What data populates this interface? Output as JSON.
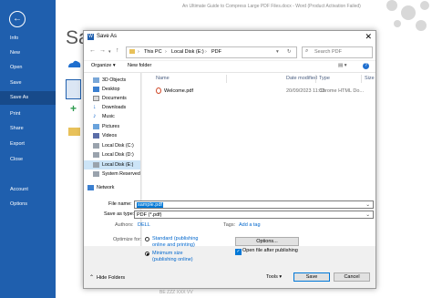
{
  "word": {
    "title": "An Ultimate Guide to Compress Large PDF Files.docx - Word (Product Activation Failed)",
    "heading_partial": "Sa",
    "sidebar": [
      {
        "label": "Info"
      },
      {
        "label": "New"
      },
      {
        "label": "Open"
      },
      {
        "label": "Save"
      },
      {
        "label": "Save As"
      },
      {
        "label": "Print"
      },
      {
        "label": "Share"
      },
      {
        "label": "Export"
      },
      {
        "label": "Close"
      },
      {
        "label": "Account"
      },
      {
        "label": "Options"
      }
    ],
    "active_item": "Save As",
    "bottom_text": "BE  ZZZ XXX VV"
  },
  "dialog": {
    "title": "Save As",
    "close_glyph": "✕",
    "breadcrumbs": [
      "This PC",
      "Local Disk (E:)",
      "PDF"
    ],
    "search_placeholder": "Search PDF",
    "toolbar": {
      "organize": "Organize ▾",
      "new_folder": "New folder"
    },
    "nav_items": [
      {
        "label": "3D Objects"
      },
      {
        "label": "Desktop"
      },
      {
        "label": "Documents"
      },
      {
        "label": "Downloads"
      },
      {
        "label": "Music"
      },
      {
        "label": "Pictures"
      },
      {
        "label": "Videos"
      },
      {
        "label": "Local Disk (C:)"
      },
      {
        "label": "Local Disk (D:)"
      },
      {
        "label": "Local Disk (E:)"
      },
      {
        "label": "System Reserved"
      },
      {
        "label": "Network"
      }
    ],
    "columns": {
      "name": "Name",
      "date": "Date modified",
      "type": "Type",
      "size": "Size"
    },
    "files": [
      {
        "name": "Welcome.pdf",
        "date": "20/09/2023 11:33",
        "type": "Chrome HTML Do..."
      }
    ],
    "form": {
      "file_name_label": "File name:",
      "file_name_value": "sample.pdf",
      "save_type_label": "Save as type:",
      "save_type_value": "PDF (*.pdf)",
      "authors_label": "Authors:",
      "authors_value": "DELL",
      "tags_label": "Tags:",
      "tags_value": "Add a tag",
      "optimize_label": "Optimize for:",
      "option_standard": "Standard (publishing\nonline and printing)",
      "option_standard_1": "Standard (publishing",
      "option_standard_2": "online and printing)",
      "option_min_1": "Minimum size",
      "option_min_2": "(publishing online)",
      "options_btn": "Options...",
      "open_after": "Open file after publishing"
    },
    "footer": {
      "hide_folders": "Hide Folders",
      "tools": "Tools ▾",
      "save": "Save",
      "cancel": "Cancel"
    }
  },
  "colors": {
    "word_blue": "#1f5fae",
    "accent": "#0078d7"
  }
}
